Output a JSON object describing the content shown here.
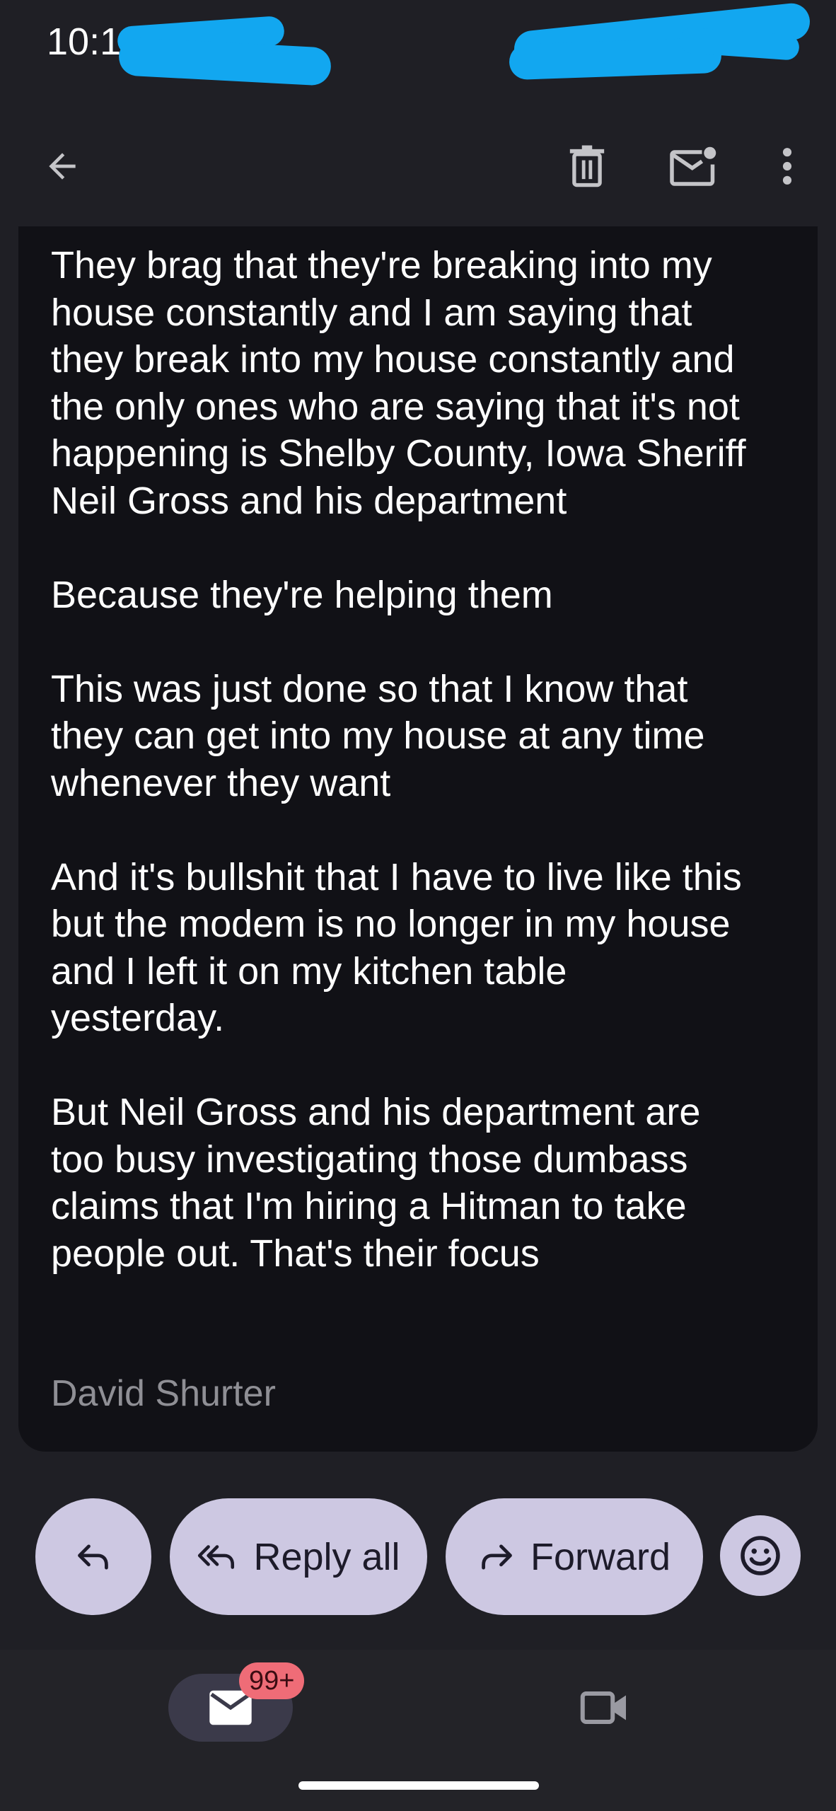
{
  "status_bar": {
    "time": "10:11"
  },
  "app_bar": {
    "back_icon": "arrow-back-icon",
    "delete_icon": "trash-icon",
    "mark_unread_icon": "mail-unread-icon",
    "more_icon": "more-vertical-icon"
  },
  "email": {
    "paragraphs": [
      "They brag that they're breaking into my\nhouse constantly and I am saying that\nthey break into my house constantly and\nthe only ones who are saying that it's not\nhappening is Shelby County, Iowa Sheriff\nNeil Gross and his department",
      "Because they're helping them",
      "This was just done so that I know that\nthey can get into my house at any time\nwhenever they want",
      "And it's bullshit that I have to live like this\nbut the modem is no longer in my house\nand I left it on my kitchen table\nyesterday.",
      "But Neil Gross and his department are\ntoo busy investigating those dumbass\nclaims that I'm hiring a Hitman to take\npeople out. That's their focus"
    ],
    "signature": "David Shurter"
  },
  "actions": {
    "reply_icon": "reply-icon",
    "reply_all_label": "Reply all",
    "forward_label": "Forward",
    "emoji_icon": "emoji-icon"
  },
  "bottom_nav": {
    "mail_badge": "99+",
    "mail_icon": "mail-icon",
    "meet_icon": "video-camera-icon"
  },
  "colors": {
    "background": "#1f1f25",
    "card": "#111116",
    "button": "#cdc8e2",
    "badge": "#ef6c77",
    "redaction": "#12a7f0"
  }
}
